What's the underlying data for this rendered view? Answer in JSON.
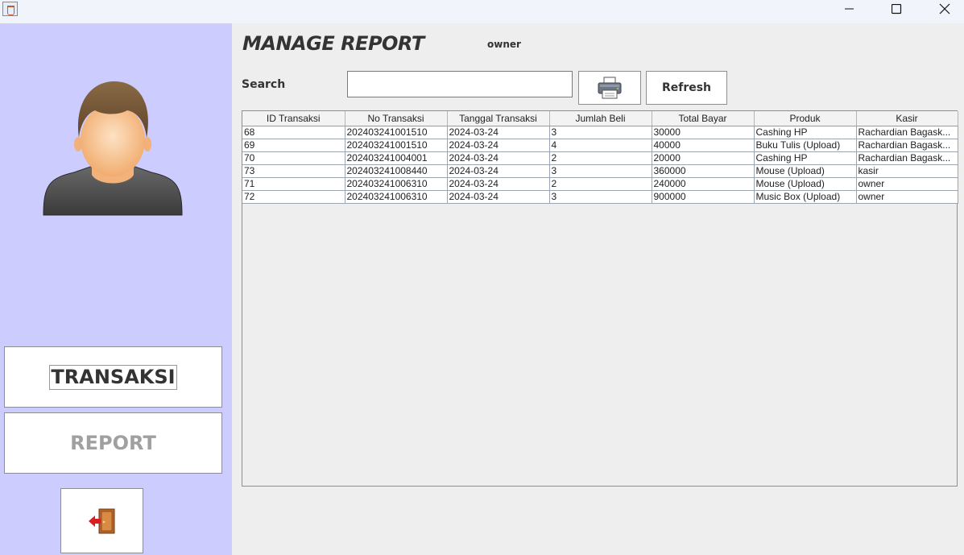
{
  "window": {
    "minimize_icon": "minimize-icon",
    "maximize_icon": "maximize-icon",
    "close_icon": "close-icon"
  },
  "sidebar": {
    "transaksi_label": "TRANSAKSI",
    "report_label": "REPORT",
    "exit_icon": "exit-door-icon"
  },
  "header": {
    "title": "MANAGE REPORT",
    "user": "owner"
  },
  "search": {
    "label": "Search",
    "value": "",
    "placeholder": ""
  },
  "toolbar": {
    "print_icon": "printer-icon",
    "refresh_label": "Refresh"
  },
  "table": {
    "columns": [
      "ID Transaksi",
      "No Transaksi",
      "Tanggal Transaksi",
      "Jumlah Beli",
      "Total Bayar",
      "Produk",
      "Kasir"
    ],
    "rows": [
      [
        "68",
        "202403241001510",
        "2024-03-24",
        "3",
        "30000",
        "Cashing HP",
        "Rachardian Bagask..."
      ],
      [
        "69",
        "202403241001510",
        "2024-03-24",
        "4",
        "40000",
        "Buku Tulis (Upload)",
        "Rachardian Bagask..."
      ],
      [
        "70",
        "202403241004001",
        "2024-03-24",
        "2",
        "20000",
        "Cashing HP",
        "Rachardian Bagask..."
      ],
      [
        "73",
        "202403241008440",
        "2024-03-24",
        "3",
        "360000",
        "Mouse (Upload)",
        "kasir"
      ],
      [
        "71",
        "202403241006310",
        "2024-03-24",
        "2",
        "240000",
        "Mouse (Upload)",
        "owner"
      ],
      [
        "72",
        "202403241006310",
        "2024-03-24",
        "3",
        "900000",
        "Music Box (Upload)",
        "owner"
      ]
    ]
  }
}
